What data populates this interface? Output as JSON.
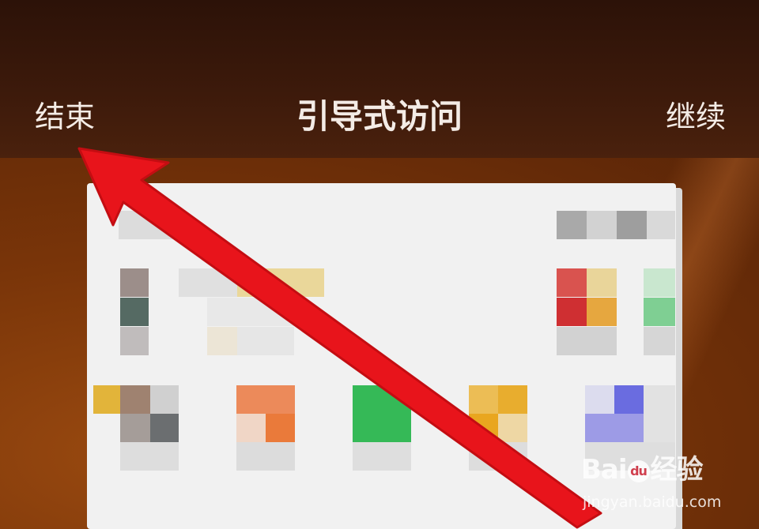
{
  "top_bar": {
    "end_label": "结束",
    "title": "引导式访问",
    "continue_label": "继续"
  },
  "watermark": {
    "logo_lead": "Bai",
    "logo_paw": "du",
    "logo_tail": "经验",
    "url": "jingyan.baidu.com"
  },
  "colors": {
    "bar_background": "#3d1a0b",
    "wallpaper": "#7a3509",
    "arrow": "#e8141b",
    "preview_background": "#f1f1f1"
  }
}
